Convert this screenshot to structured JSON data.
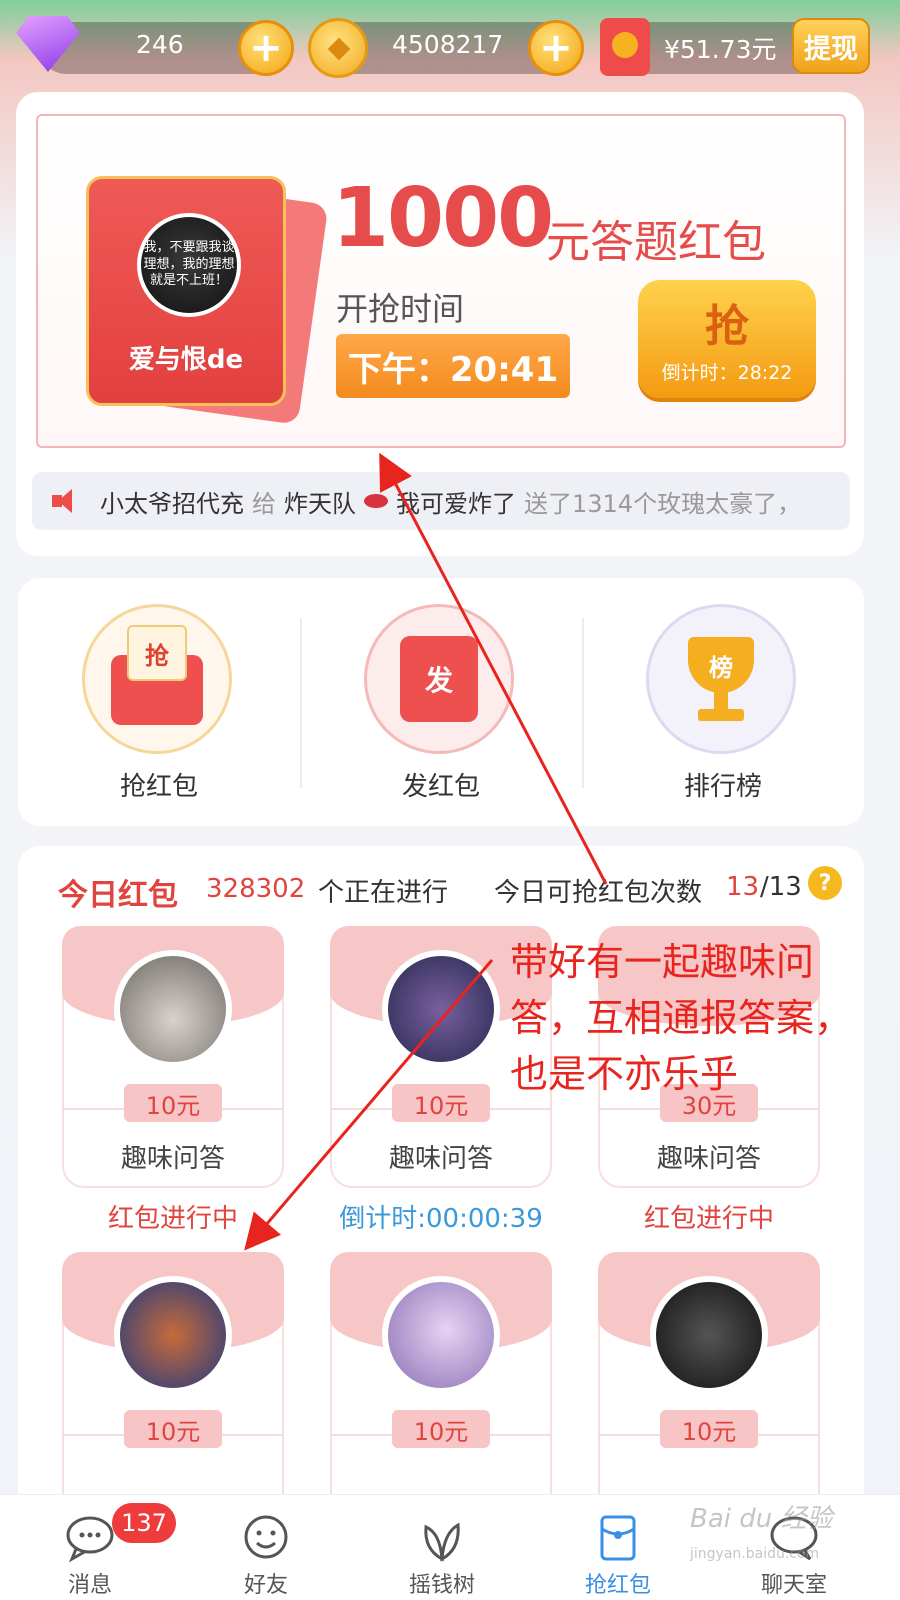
{
  "topbar": {
    "gems": "246",
    "coins": "4508217",
    "balance": "¥51.73元",
    "withdraw_label": "提现",
    "plus_label": "+"
  },
  "hero": {
    "bag_avatar_text": "我，不要跟我谈理想，我的理想就是不上班！",
    "bag_name": "爱与恨de",
    "amount": "1000",
    "amount_suffix": "元答题红包",
    "time_label": "开抢时间",
    "time": "下午：20:41",
    "grab_label": "抢",
    "countdown": "倒计时：28:22"
  },
  "ticker": {
    "sender": "小太爷招代充",
    "give": "给",
    "receiver1": "炸天队",
    "receiver2": "我可爱炸了",
    "message": "送了1314个玫瑰太豪了，"
  },
  "actions": [
    {
      "label": "抢红包",
      "glyph": "抢"
    },
    {
      "label": "发红包",
      "glyph": "发"
    },
    {
      "label": "排行榜",
      "glyph": "榜"
    }
  ],
  "today": {
    "title": "今日红包",
    "count": "328302",
    "count_label": "个正在进行",
    "quota_label": "今日可抢红包次数",
    "quota": "13",
    "quota_total": "/13",
    "help": "?"
  },
  "cards": [
    {
      "price": "10元",
      "type": "趣味问答",
      "status": "红包进行中"
    },
    {
      "price": "10元",
      "type": "趣味问答",
      "status": "倒计时:00:00:39"
    },
    {
      "price": "30元",
      "type": "趣味问答",
      "status": "红包进行中"
    },
    {
      "price": "10元",
      "type": "",
      "status": ""
    },
    {
      "price": "10元",
      "type": "",
      "status": ""
    },
    {
      "price": "10元",
      "type": "",
      "status": ""
    }
  ],
  "annotation": "带好有一起趣味问答，互相通报答案，也是不亦乐乎",
  "tabs": [
    {
      "label": "消息",
      "badge": "137"
    },
    {
      "label": "好友"
    },
    {
      "label": "摇钱树"
    },
    {
      "label": "抢红包",
      "active": true
    },
    {
      "label": "聊天室"
    }
  ],
  "watermark": {
    "title": "Bai du 经验",
    "sub": "jingyan.baidu.com"
  },
  "colors": {
    "accent_red": "#e0443e",
    "countdown_blue": "#3a9ad9",
    "tab_active": "#3a8fe6",
    "annotation_red": "#e8241e"
  }
}
